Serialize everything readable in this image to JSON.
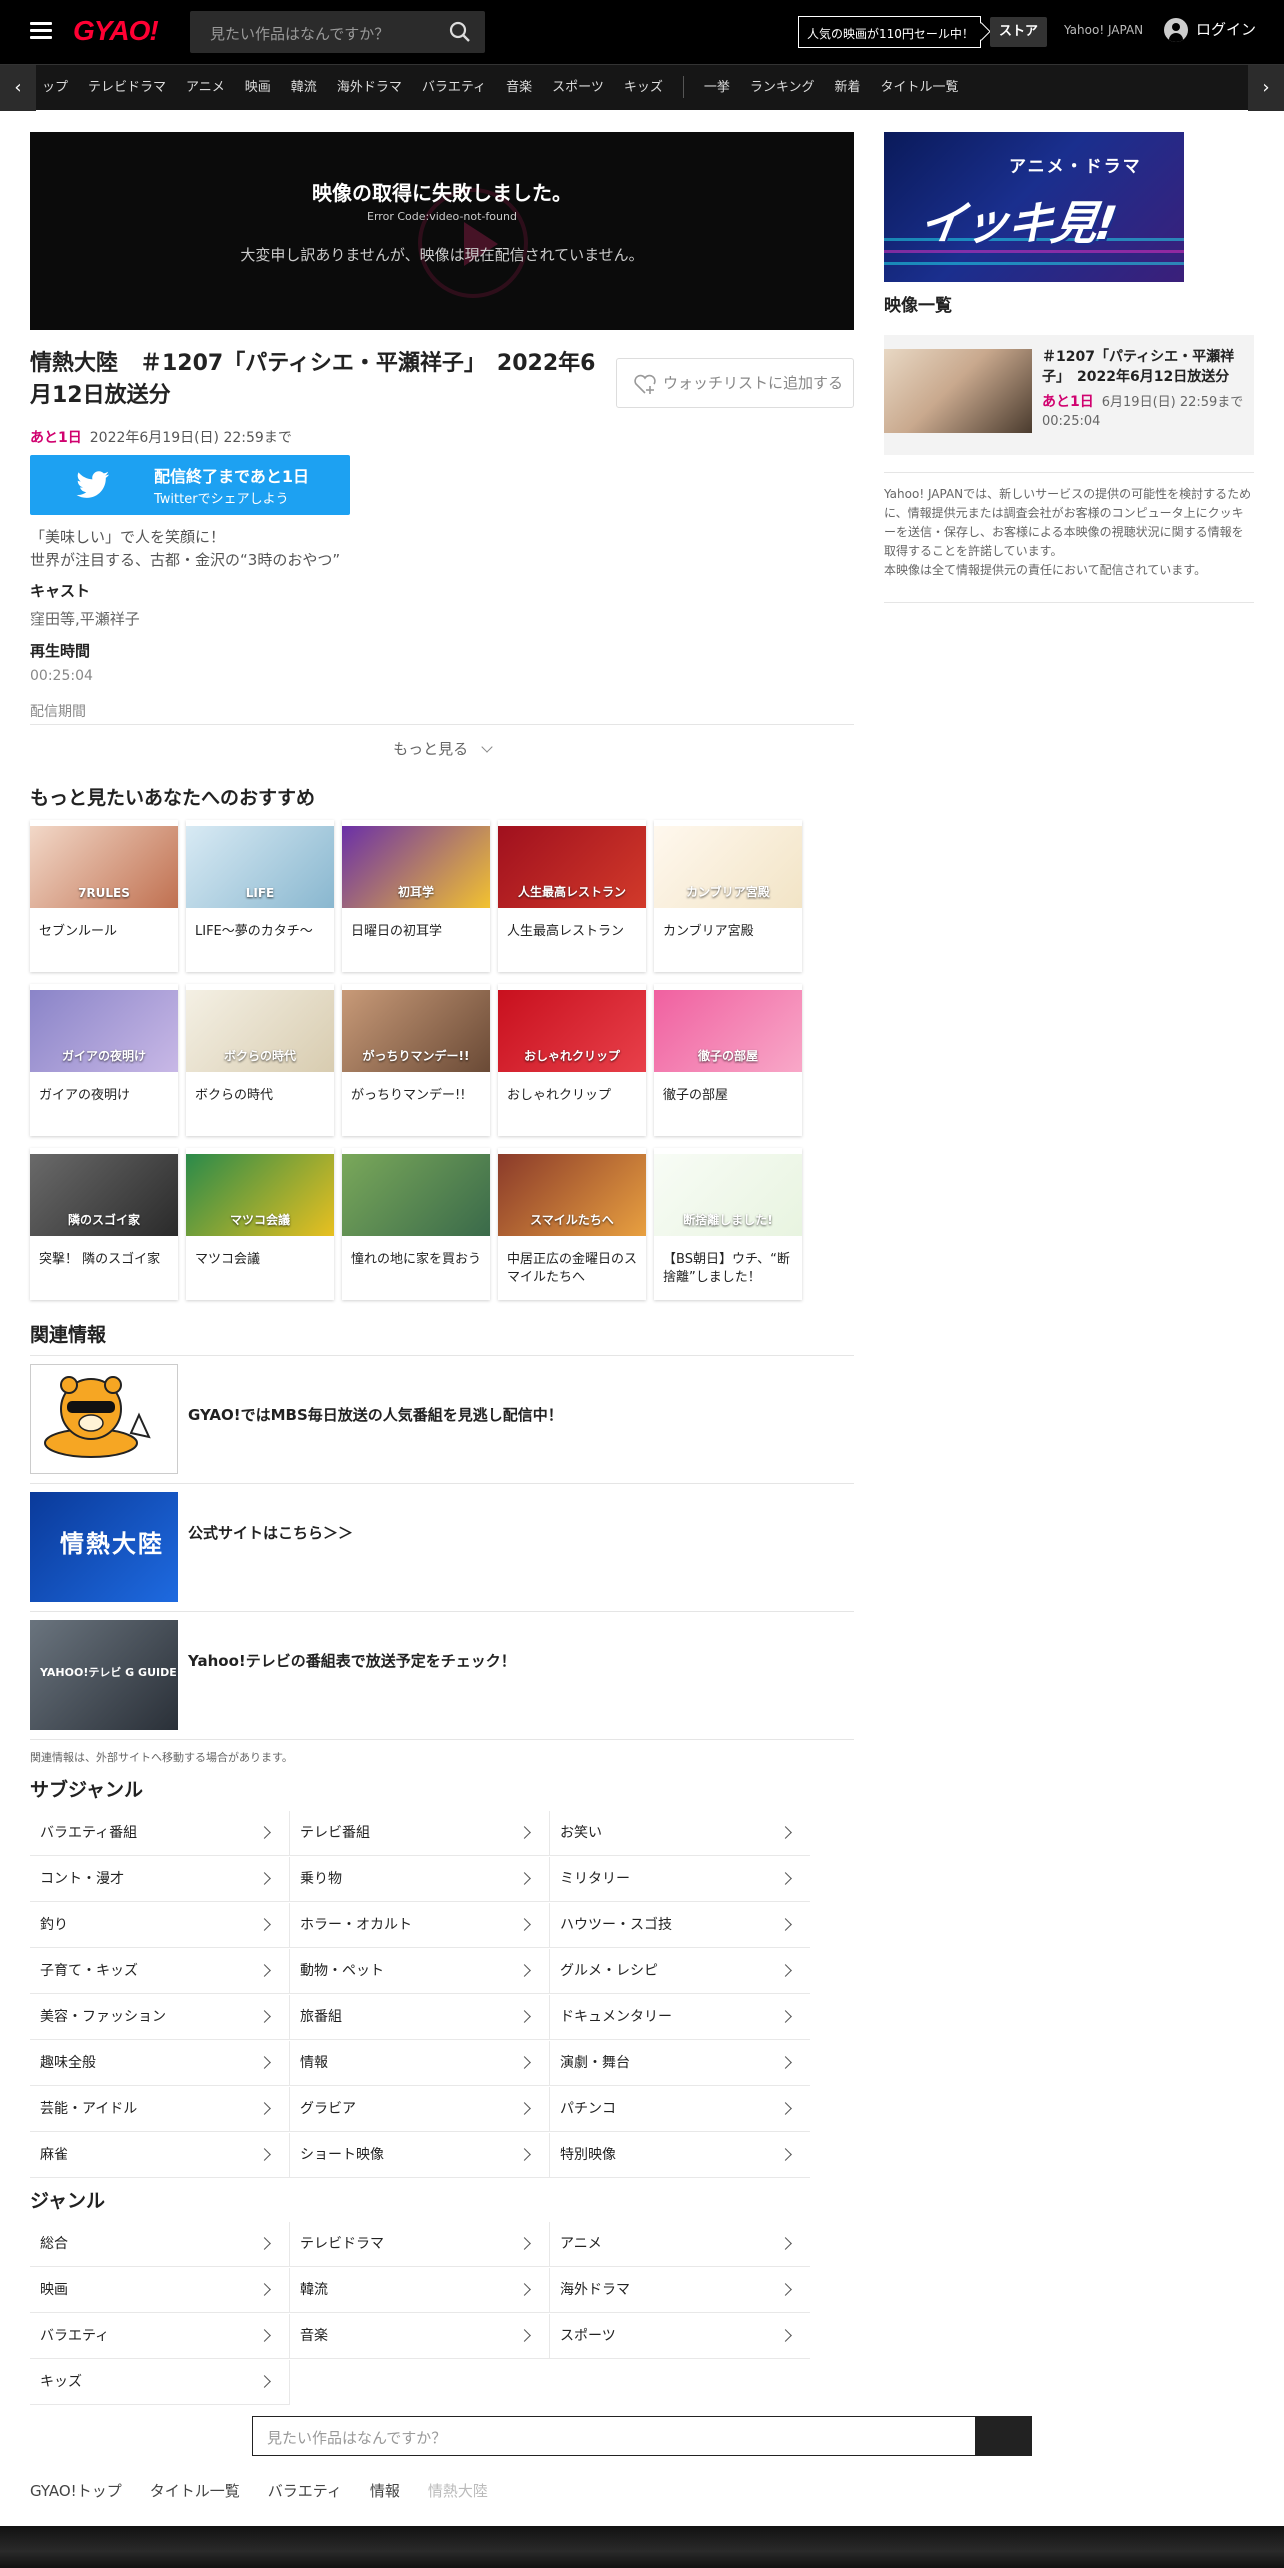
{
  "header": {
    "logo": "GYAO!",
    "search_placeholder": "見たい作品はなんですか？",
    "sale_banner": "人気の映画が110円セール中！",
    "store": "ストア",
    "yahoo_link": "Yahoo! JAPAN",
    "login": "ログイン"
  },
  "genre_nav": [
    "ップ",
    "テレビドラマ",
    "アニメ",
    "映画",
    "韓流",
    "海外ドラマ",
    "バラエティ",
    "音楽",
    "スポーツ",
    "キッズ",
    "|",
    "一挙",
    "ランキング",
    "新着",
    "タイトル一覧"
  ],
  "player": {
    "error_title": "映像の取得に失敗しました。",
    "error_code": "Error Code:video-not-found",
    "error_message": "大変申し訳ありませんが、映像は現在配信されていません。"
  },
  "episode": {
    "title": "情熱大陸　＃1207「パティシエ・平瀬祥子」　2022年6月12日放送分",
    "watchlist": "ウォッチリストに追加する",
    "remain_label": "あと1日",
    "remain_date": "2022年6月19日(日) 22:59まで",
    "twitter_line1": "配信終了まであと1日",
    "twitter_line2": "Twitterでシェアしよう",
    "desc_line1": "「美味しい」で人を笑顔に！",
    "desc_line2": "世界が注目する、古都・金沢の“3時のおやつ”",
    "cast_label": "キャスト",
    "cast_value": "窪田等,平瀬祥子",
    "duration_label": "再生時間",
    "duration_value": "00:25:04",
    "period_label": "配信期間",
    "more": "もっと見る"
  },
  "recommend": {
    "heading": "もっと見たいあなたへのおすすめ",
    "items": [
      {
        "title": "セブンルール",
        "thumb_label": "7RULES",
        "c1": "#f2d8c8",
        "c2": "#c07050"
      },
      {
        "title": "LIFE～夢のカタチ～",
        "thumb_label": "LIFE",
        "c1": "#d8eaf4",
        "c2": "#89b7cf"
      },
      {
        "title": "日曜日の初耳学",
        "thumb_label": "初耳学",
        "c1": "#6a2fa8",
        "c2": "#f2c230"
      },
      {
        "title": "人生最高レストラン",
        "thumb_label": "人生最高レストラン",
        "c1": "#a0101e",
        "c2": "#d23a2a"
      },
      {
        "title": "カンブリア宮殿",
        "thumb_label": "カンブリア宮殿",
        "c1": "#fff8ee",
        "c2": "#f2e4c6"
      },
      {
        "title": "ガイアの夜明け",
        "thumb_label": "ガイアの夜明け",
        "c1": "#8a84c8",
        "c2": "#c8b8e6"
      },
      {
        "title": "ボクらの時代",
        "thumb_label": "ボクらの時代",
        "c1": "#f4f0e4",
        "c2": "#d8ccb0"
      },
      {
        "title": "がっちりマンデー!!",
        "thumb_label": "がっちりマンデー!!",
        "c1": "#c89a78",
        "c2": "#6a4a36"
      },
      {
        "title": "おしゃれクリップ",
        "thumb_label": "おしゃれクリップ",
        "c1": "#c8101e",
        "c2": "#e8404a"
      },
      {
        "title": "徹子の部屋",
        "thumb_label": "徹子の部屋",
        "c1": "#f060a0",
        "c2": "#f8a8c8"
      },
      {
        "title": "突撃！ 隣のスゴイ家",
        "thumb_label": "隣のスゴイ家",
        "c1": "#6a6a6a",
        "c2": "#2a2a2a"
      },
      {
        "title": "マツコ会議",
        "thumb_label": "マツコ会議",
        "c1": "#2a8a4a",
        "c2": "#e8c020"
      },
      {
        "title": "憧れの地に家を買おう",
        "thumb_label": "",
        "c1": "#7aa85a",
        "c2": "#3a6a4a"
      },
      {
        "title": "中居正広の金曜日のスマイルたちへ",
        "thumb_label": "スマイルたちへ",
        "c1": "#8a3a2a",
        "c2": "#e8a040"
      },
      {
        "title": "【BS朝日】ウチ、“断捨離”しました！",
        "thumb_label": "断捨離しました!",
        "c1": "#f8fcf6",
        "c2": "#e8f4e0"
      }
    ]
  },
  "related": {
    "heading": "関連情報",
    "items": [
      {
        "text": "GYAO!ではMBS毎日放送の人気番組を見逃し配信中！",
        "thumb": "mbs"
      },
      {
        "text": "公式サイトはこちら＞＞",
        "thumb": "jounetsu"
      },
      {
        "text": "Yahoo!テレビの番組表で放送予定をチェック！",
        "thumb": "yahoo-tv"
      }
    ],
    "note": "関連情報は、外部サイトへ移動する場合があります。",
    "mbs_thumb_label": "",
    "jounetsu_thumb_label": "情熱大陸",
    "yahootv_thumb_label": "YAHOO!テレビ G GUIDE"
  },
  "subgenre": {
    "heading": "サブジャンル",
    "items": [
      "バラエティ番組",
      "テレビ番組",
      "お笑い",
      "コント・漫才",
      "乗り物",
      "ミリタリー",
      "釣り",
      "ホラー・オカルト",
      "ハウツー・スゴ技",
      "子育て・キッズ",
      "動物・ペット",
      "グルメ・レシピ",
      "美容・ファッション",
      "旅番組",
      "ドキュメンタリー",
      "趣味全般",
      "情報",
      "演劇・舞台",
      "芸能・アイドル",
      "グラビア",
      "パチンコ",
      "麻雀",
      "ショート映像",
      "特別映像"
    ]
  },
  "genre": {
    "heading": "ジャンル",
    "items": [
      "総合",
      "テレビドラマ",
      "アニメ",
      "映画",
      "韓流",
      "海外ドラマ",
      "バラエティ",
      "音楽",
      "スポーツ",
      "キッズ"
    ]
  },
  "bottom_search_placeholder": "見たい作品はなんですか？",
  "breadcrumb": [
    "GYAO!トップ",
    "タイトル一覧",
    "バラエティ",
    "情報",
    "情熱大陸"
  ],
  "right": {
    "banner_line1": "アニメ・ドラマ",
    "banner_line2": "イッキ見!",
    "list_heading": "映像一覧",
    "item_title": "＃1207「パティシエ・平瀬祥子」　2022年6月12日放送分",
    "item_remain": "あと1日",
    "item_date": "6月19日(日) 22:59まで",
    "item_duration": "00:25:04",
    "notice": "Yahoo! JAPANでは、新しいサービスの提供の可能性を検討するために、情報提供元または調査会社がお客様のコンピュータ上にクッキーを送信・保存し、お客様による本映像の視聴状況に関する情報を取得することを許諾しています。\n本映像は全て情報提供元の責任において配信されています。"
  },
  "colors": {
    "accent_pink": "#d0016f",
    "twitter": "#1da1f2",
    "logo_red": "#ff0033"
  }
}
